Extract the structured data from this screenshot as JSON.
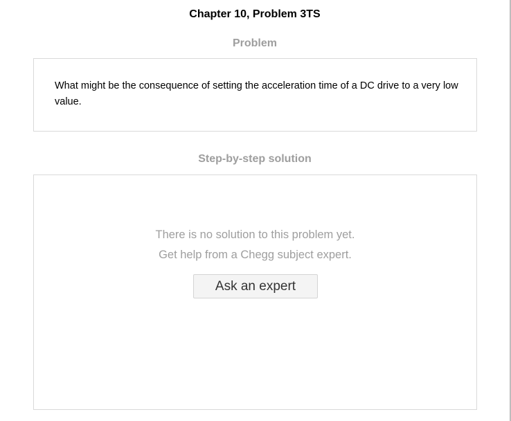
{
  "header": {
    "title": "Chapter 10, Problem 3TS"
  },
  "problem": {
    "heading": "Problem",
    "text": "What might be the consequence of setting the acceleration time of a DC drive to a very low value."
  },
  "solution": {
    "heading": "Step-by-step solution",
    "message_line_1": "There is no solution to this problem yet.",
    "message_line_2": "Get help from a Chegg subject expert.",
    "button_label": "Ask an expert"
  }
}
